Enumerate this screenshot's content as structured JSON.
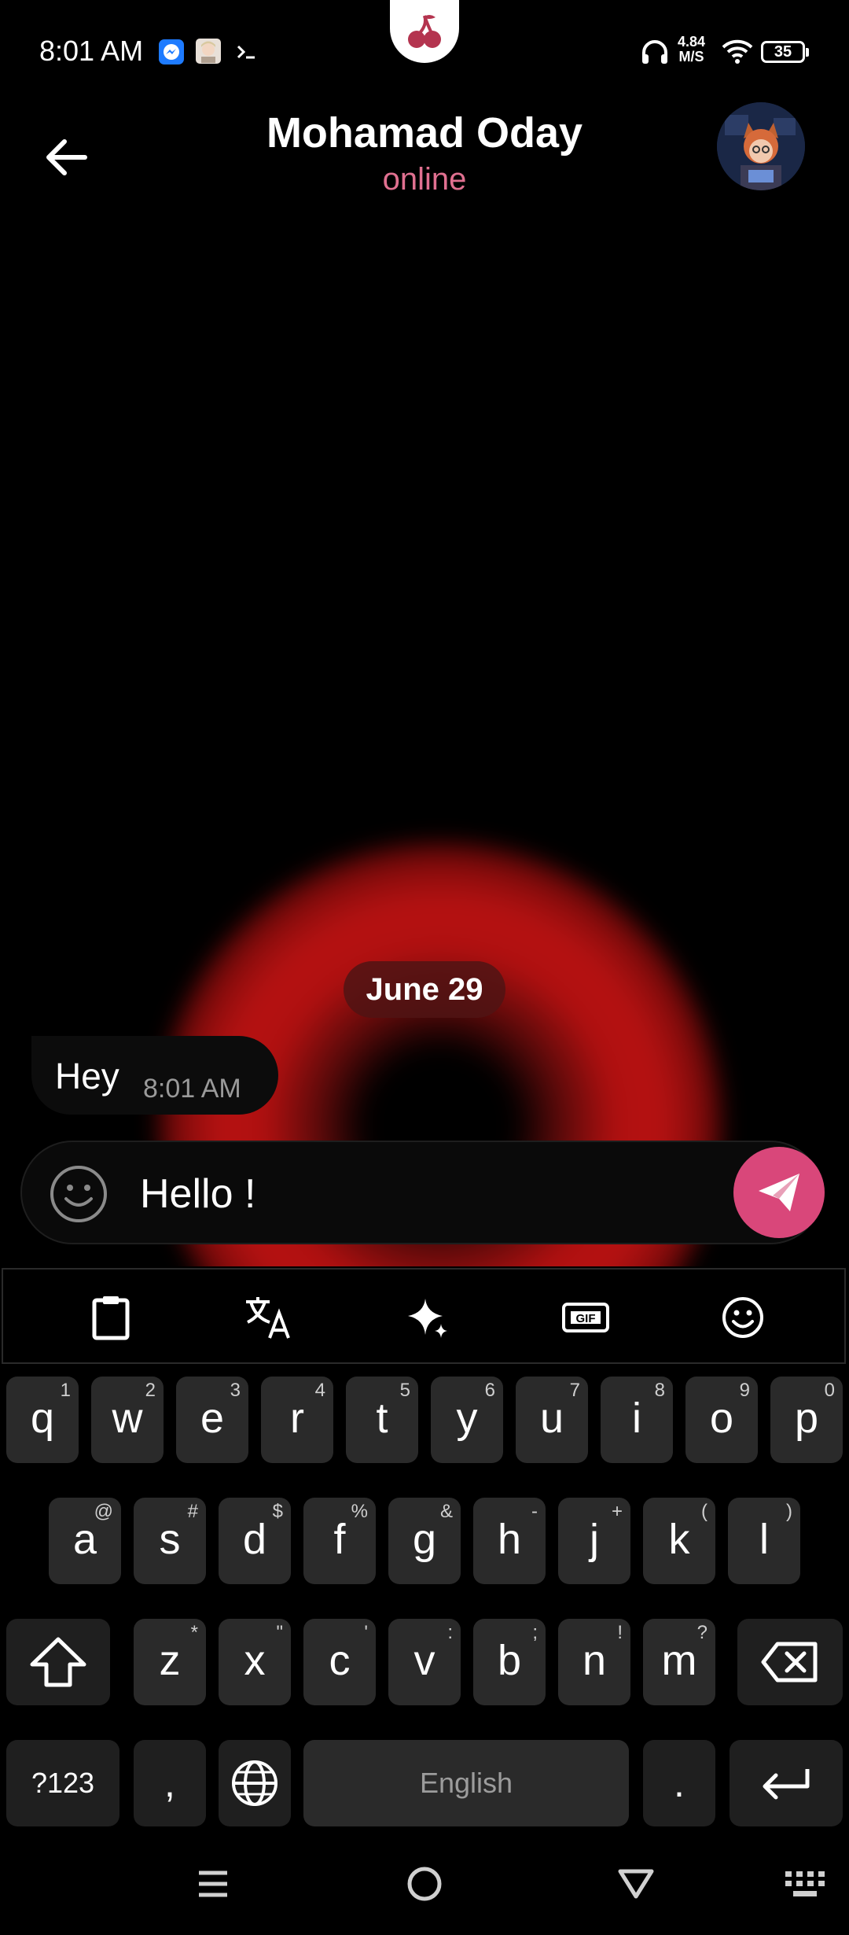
{
  "status_bar": {
    "time": "8:01 AM",
    "net_speed_value": "4.84",
    "net_speed_unit": "M/S",
    "battery": "35",
    "icons": [
      "messenger-icon",
      "app-avatar-icon",
      "terminal-icon",
      "cherry-icon",
      "headphones-icon",
      "wifi-icon",
      "battery-icon"
    ]
  },
  "header": {
    "title": "Mohamad Oday",
    "status": "online"
  },
  "chat": {
    "date_chip": "June 29",
    "messages": [
      {
        "text": "Hey",
        "time": "8:01 AM",
        "direction": "incoming"
      }
    ],
    "background_accent": "#b01010"
  },
  "composer": {
    "value": "Hello !",
    "send_color": "#d9477a"
  },
  "keyboard": {
    "toolbar": [
      "clipboard-icon",
      "translate-icon",
      "sparkle-icon",
      "gif-icon",
      "emoji-icon"
    ],
    "row1": [
      {
        "k": "q",
        "h": "1"
      },
      {
        "k": "w",
        "h": "2"
      },
      {
        "k": "e",
        "h": "3"
      },
      {
        "k": "r",
        "h": "4"
      },
      {
        "k": "t",
        "h": "5"
      },
      {
        "k": "y",
        "h": "6"
      },
      {
        "k": "u",
        "h": "7"
      },
      {
        "k": "i",
        "h": "8"
      },
      {
        "k": "o",
        "h": "9"
      },
      {
        "k": "p",
        "h": "0"
      }
    ],
    "row2": [
      {
        "k": "a",
        "h": "@"
      },
      {
        "k": "s",
        "h": "#"
      },
      {
        "k": "d",
        "h": "$"
      },
      {
        "k": "f",
        "h": "%"
      },
      {
        "k": "g",
        "h": "&"
      },
      {
        "k": "h",
        "h": "-"
      },
      {
        "k": "j",
        "h": "+"
      },
      {
        "k": "k",
        "h": "("
      },
      {
        "k": "l",
        "h": ")"
      }
    ],
    "row3": [
      {
        "k": "z",
        "h": "*"
      },
      {
        "k": "x",
        "h": "\""
      },
      {
        "k": "c",
        "h": "'"
      },
      {
        "k": "v",
        "h": ":"
      },
      {
        "k": "b",
        "h": ";"
      },
      {
        "k": "n",
        "h": "!"
      },
      {
        "k": "m",
        "h": "?"
      }
    ],
    "symbols_label": "?123",
    "comma": ",",
    "space_label": "English",
    "period": "."
  }
}
